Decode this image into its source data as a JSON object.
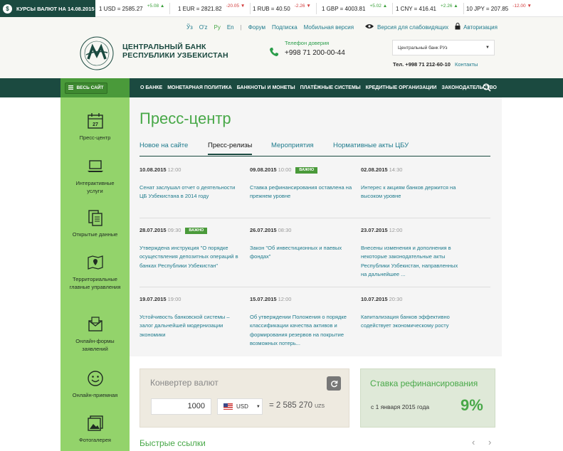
{
  "ticker": {
    "label": "КУРСЫ ВАЛЮТ НА 14.08.2015",
    "rates": [
      {
        "text": "1 USD = 2585.27",
        "change": "+5.08",
        "dir": "up"
      },
      {
        "text": "1 EUR = 2821.82",
        "change": "-20.05",
        "dir": "dn"
      },
      {
        "text": "1 RUB = 40.50",
        "change": "-2.26",
        "dir": "dn"
      },
      {
        "text": "1 GBP = 4003.81",
        "change": "+5.02",
        "dir": "up"
      },
      {
        "text": "1 CNY = 416.41",
        "change": "+2.26",
        "dir": "up"
      },
      {
        "text": "10 JPY = 207.85",
        "change": "-12.00",
        "dir": "dn"
      }
    ]
  },
  "header": {
    "langs": [
      "Ўз",
      "O'z",
      "Ру",
      "En"
    ],
    "links": [
      "Форум",
      "Подписка",
      "Мобильная версия"
    ],
    "accessibility": "Версия для слабовидящих",
    "auth": "Авторизация",
    "bank_name_1": "ЦЕНТРАЛЬНЫЙ БАНК",
    "bank_name_2": "РЕСПУБЛИКИ УЗБЕКИСТАН",
    "phone_label": "Телефон доверия",
    "phone": "+998 71 200-00-44",
    "bank_select": "Центральный банк РУз",
    "contact_tel": "Тел. +998 71 212-60-10",
    "contacts": "Контакты"
  },
  "nav": {
    "all_site": "ВЕСЬ САЙТ",
    "items": [
      "О БАНКЕ",
      "МОНЕТАРНАЯ ПОЛИТИКА",
      "БАНКНОТЫ И МОНЕТЫ",
      "ПЛАТЁЖНЫЕ СИСТЕМЫ",
      "КРЕДИТНЫЕ ОРГАНИЗАЦИИ",
      "ЗАКОНОДАТЕЛЬСТВО"
    ]
  },
  "sidebar": {
    "calendar_day": "27",
    "items": [
      "Пресс-центр",
      "Интерактивные услуги",
      "Открытые данные",
      "Территориальные главные управления",
      "Онлайн-формы заявлений",
      "Онлайн-приемная",
      "Фотогалерея"
    ]
  },
  "main": {
    "title": "Пресс-центр",
    "tabs": [
      "Новое на сайте",
      "Пресс-релизы",
      "Мероприятия",
      "Нормативные акты ЦБУ"
    ],
    "news": [
      {
        "date": "10.08.2015",
        "time": "12:00",
        "badge": "",
        "text": "Сенат заслушал отчет о деятельности ЦБ Узбекистана в 2014 году"
      },
      {
        "date": "09.08.2015",
        "time": "10:00",
        "badge": "ВАЖНО",
        "text": "Ставка рефинансирования оставлена на прежнем уровне"
      },
      {
        "date": "02.08.2015",
        "time": "14:30",
        "badge": "",
        "text": "Интерес к акциям банков держится на высоком уровне"
      },
      {
        "date": "28.07.2015",
        "time": "09:30",
        "badge": "ВАЖНО",
        "text": "Утверждена инструкция \"О порядке осуществления депозитных операций в банках Республики Узбекистан\""
      },
      {
        "date": "26.07.2015",
        "time": "08:30",
        "badge": "",
        "text": "Закон \"Об инвестиционных и паевых фондах\""
      },
      {
        "date": "23.07.2015",
        "time": "12:00",
        "badge": "",
        "text": "Внесены изменения и дополнения в некоторые законодательные акты Республики Узбекистан, направленных на дальнейшее ..."
      },
      {
        "date": "19.07.2015",
        "time": "19:00",
        "badge": "",
        "text": "Устойчивость банковской системы – залог дальнейшей модернизации экономики"
      },
      {
        "date": "15.07.2015",
        "time": "12:00",
        "badge": "",
        "text": "Об утверждении Положения о порядке классификации качества активов и формирования резервов на покрытие возможных потерь..."
      },
      {
        "date": "10.07.2015",
        "time": "20:30",
        "badge": "",
        "text": "Капитализация банков эффективно содействует экономическому росту"
      }
    ]
  },
  "converter": {
    "title": "Конвертер валют",
    "amount": "1000",
    "currency": "USD",
    "equals": "=",
    "result": "2 585 270",
    "result_unit": "UZS"
  },
  "refinance": {
    "title": "Ставка рефинансирования",
    "date": "с 1 января 2015 года",
    "value": "9%"
  },
  "quick_links": {
    "title": "Быстрые ссылки",
    "prev": "‹",
    "next": "›"
  },
  "colors": {
    "dark_green": "#1b4a40",
    "bright_green": "#93d36b",
    "accent_green": "#48a848",
    "link_teal": "#1d7a8c"
  }
}
